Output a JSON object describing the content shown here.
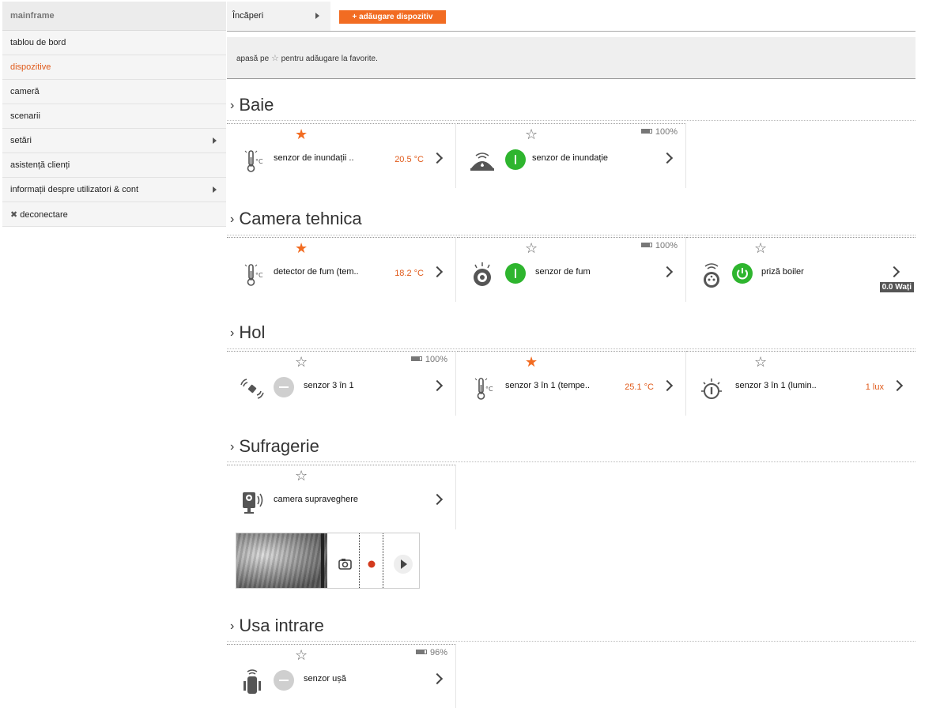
{
  "sidebar": {
    "header": "mainframe",
    "items": [
      {
        "label": "tablou de bord"
      },
      {
        "label": "dispozitive"
      },
      {
        "label": "cameră"
      },
      {
        "label": "scenarii"
      },
      {
        "label": "setări"
      },
      {
        "label": "asistență clienți"
      },
      {
        "label": "informații despre utilizatori & cont"
      },
      {
        "label": "deconectare"
      }
    ]
  },
  "topbar": {
    "rooms_label": "Încăperi",
    "add_button": "+ adăugare dispozitiv"
  },
  "hint": {
    "before": "apasă pe",
    "after": "pentru adăugare la favorite."
  },
  "rooms": [
    {
      "title": "Baie",
      "devices": [
        {
          "name": "senzor de inundații ..",
          "value": "20.5 °C",
          "favorite": true,
          "icon": "thermometer-icon"
        },
        {
          "name": "senzor de inundație",
          "battery": "100%",
          "favorite": false,
          "icon": "flood-sensor-icon",
          "toggle": "on"
        }
      ]
    },
    {
      "title": "Camera tehnica",
      "devices": [
        {
          "name": "detector de fum (tem..",
          "value": "18.2 °C",
          "favorite": true,
          "icon": "thermometer-icon"
        },
        {
          "name": "senzor de fum",
          "battery": "100%",
          "favorite": false,
          "icon": "smoke-detector-icon",
          "toggle": "on"
        },
        {
          "name": "priză boiler",
          "favorite": false,
          "icon": "smart-plug-icon",
          "toggle": "on",
          "power": "0.0 Wați"
        }
      ]
    },
    {
      "title": "Hol",
      "devices": [
        {
          "name": "senzor 3 în 1",
          "battery": "100%",
          "favorite": false,
          "icon": "motion-sensor-icon",
          "toggle": "off"
        },
        {
          "name": "senzor 3 în 1 (tempe..",
          "value": "25.1 °C",
          "favorite": true,
          "icon": "thermometer-icon"
        },
        {
          "name": "senzor 3 în 1 (lumin..",
          "value": "1 lux",
          "favorite": false,
          "icon": "light-sensor-icon"
        }
      ]
    },
    {
      "title": "Sufragerie",
      "devices": [
        {
          "name": "camera supraveghere",
          "favorite": false,
          "icon": "camera-icon"
        }
      ]
    },
    {
      "title": "Usa intrare",
      "devices": [
        {
          "name": "senzor ușă",
          "battery": "96%",
          "favorite": false,
          "icon": "door-sensor-icon",
          "toggle": "off"
        }
      ]
    }
  ],
  "colors": {
    "accent": "#f26c22",
    "toggle_on": "#2eb52e",
    "toggle_off": "#cfcfcf"
  }
}
